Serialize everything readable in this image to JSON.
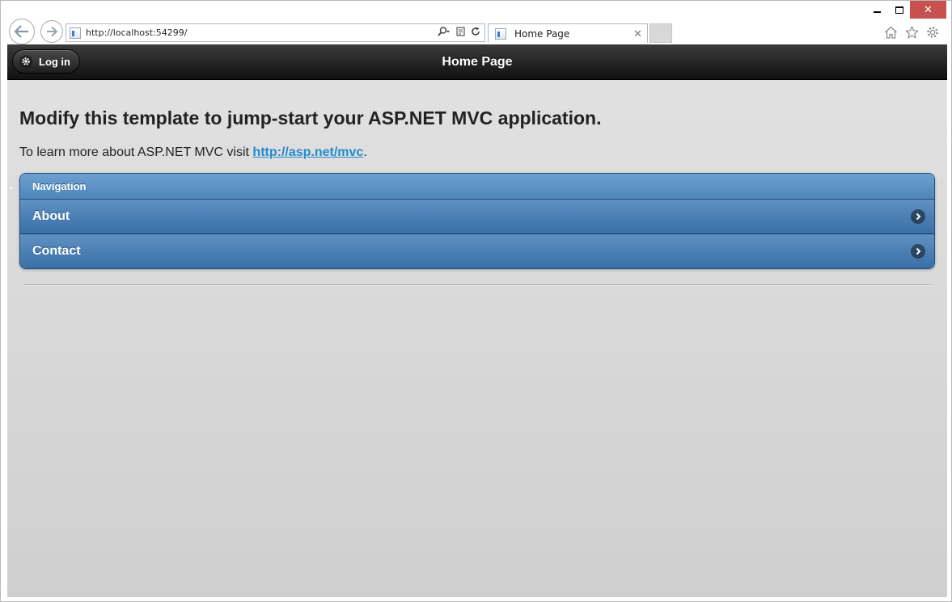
{
  "browser": {
    "url": "http://localhost:54299/",
    "tab_title": "Home Page",
    "tab_close_glyph": "✕",
    "window_close_glyph": "✕",
    "icons": {
      "back": "back-arrow-icon",
      "forward": "forward-arrow-icon",
      "search": "search-icon",
      "compat": "compatibility-view-icon",
      "refresh": "refresh-icon",
      "home": "home-icon",
      "favorites": "star-icon",
      "settings": "gear-icon"
    }
  },
  "page": {
    "header": {
      "title": "Home Page",
      "login_label": "Log in"
    },
    "heading": "Modify this template to jump-start your ASP.NET MVC application.",
    "intro_text": "To learn more about ASP.NET MVC visit ",
    "intro_link": "http://asp.net/mvc",
    "intro_end": ".",
    "navigation": {
      "title": "Navigation",
      "items": [
        {
          "label": "About"
        },
        {
          "label": "Contact"
        }
      ]
    }
  },
  "colors": {
    "header_bg": "#1e1e1e",
    "list_blue": "#4a7fb5",
    "link": "#2489ce",
    "close_red": "#c75050"
  }
}
